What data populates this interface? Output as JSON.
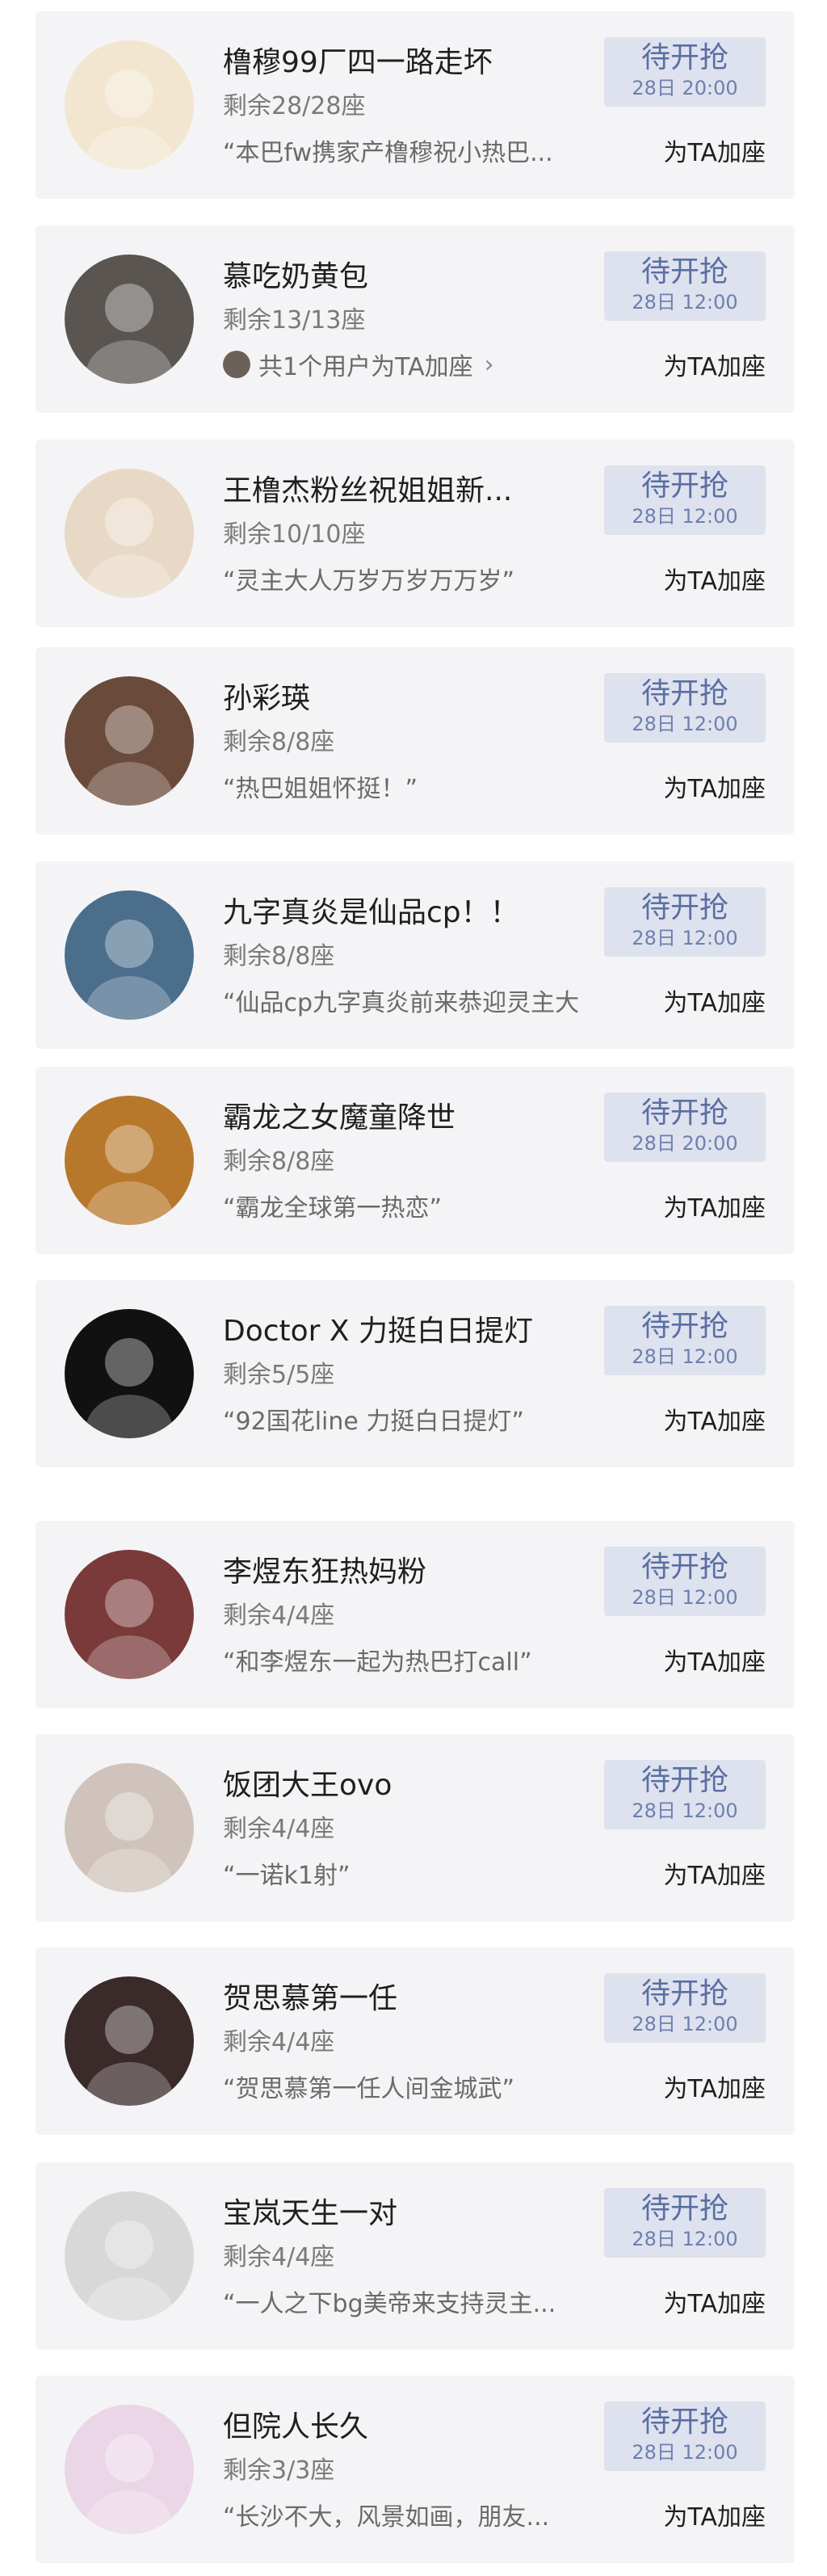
{
  "items": [
    {
      "title": "橹穆99厂四一路走坏",
      "seats": "剩余28/28座",
      "quote": "“本巴fw携家产橹穆祝小热巴...",
      "status": "待开抢",
      "time": "28日 20:00",
      "action": "为TA加座",
      "avatar_color": "#f2e6d0",
      "avatar_icon": "cartoon-cat-avatar"
    },
    {
      "title": "慕吃奶黄包",
      "seats": "剩余13/13座",
      "supporters": "共1个用户为TA加座",
      "status": "待开抢",
      "time": "28日 12:00",
      "action": "为TA加座",
      "avatar_color": "#5a5550",
      "avatar_icon": "photo-avatar"
    },
    {
      "title": "王橹杰粉丝祝姐姐新...",
      "seats": "剩余10/10座",
      "quote": "“灵主大人万岁万岁万万岁”",
      "status": "待开抢",
      "time": "28日 12:00",
      "action": "为TA加座",
      "avatar_color": "#e8d9c6",
      "avatar_icon": "flower-avatar"
    },
    {
      "title": "孙彩瑛",
      "seats": "剩余8/8座",
      "quote": "“热巴姐姐怀挺！”",
      "status": "待开抢",
      "time": "28日 12:00",
      "action": "为TA加座",
      "avatar_color": "#6a4a3a",
      "avatar_icon": "photo-avatar"
    },
    {
      "title": "九字真炎是仙品cp！！",
      "seats": "剩余8/8座",
      "quote": "“仙品cp九字真炎前来恭迎灵主大",
      "status": "待开抢",
      "time": "28日 12:00",
      "action": "为TA加座",
      "avatar_color": "#4a6e8c",
      "avatar_icon": "photo-avatar"
    },
    {
      "title": "霸龙之女魔童降世",
      "seats": "剩余8/8座",
      "quote": "“霸龙全球第一热恋”",
      "status": "待开抢",
      "time": "28日 20:00",
      "action": "为TA加座",
      "avatar_color": "#b8782c",
      "avatar_icon": "photo-avatar"
    },
    {
      "title": "Doctor X 力挺白日提灯",
      "seats": "剩余5/5座",
      "quote": "“92国花line 力挺白日提灯”",
      "status": "待开抢",
      "time": "28日 12:00",
      "action": "为TA加座",
      "avatar_color": "#111111",
      "avatar_icon": "logo-avatar"
    },
    {
      "title": "李煜东狂热妈粉",
      "seats": "剩余4/4座",
      "quote": "“和李煜东一起为热巴打call”",
      "status": "待开抢",
      "time": "28日 12:00",
      "action": "为TA加座",
      "avatar_color": "#7a3a3a",
      "avatar_icon": "photo-avatar"
    },
    {
      "title": "饭团大王ovo",
      "seats": "剩余4/4座",
      "quote": "“一诺k1射”",
      "status": "待开抢",
      "time": "28日 12:00",
      "action": "为TA加座",
      "avatar_color": "#cfc3bb",
      "avatar_icon": "kitten-avatar"
    },
    {
      "title": "贺思慕第一任",
      "seats": "剩余4/4座",
      "quote": "“贺思慕第一任人间金城武”",
      "status": "待开抢",
      "time": "28日 12:00",
      "action": "为TA加座",
      "avatar_color": "#3a2a2a",
      "avatar_icon": "photo-avatar"
    },
    {
      "title": "宝岚天生一对",
      "seats": "剩余4/4座",
      "quote": "“一人之下bg美帝来支持灵主...",
      "status": "待开抢",
      "time": "28日 12:00",
      "action": "为TA加座",
      "avatar_color": "#d8d8d8",
      "avatar_icon": "manga-avatar"
    },
    {
      "title": "但院人长久",
      "seats": "剩余3/3座",
      "quote": "“长沙不大，风景如画，朋友...",
      "status": "待开抢",
      "time": "28日 12:00",
      "action": "为TA加座",
      "avatar_color": "#ead6e6",
      "avatar_icon": "pastel-avatar"
    }
  ]
}
